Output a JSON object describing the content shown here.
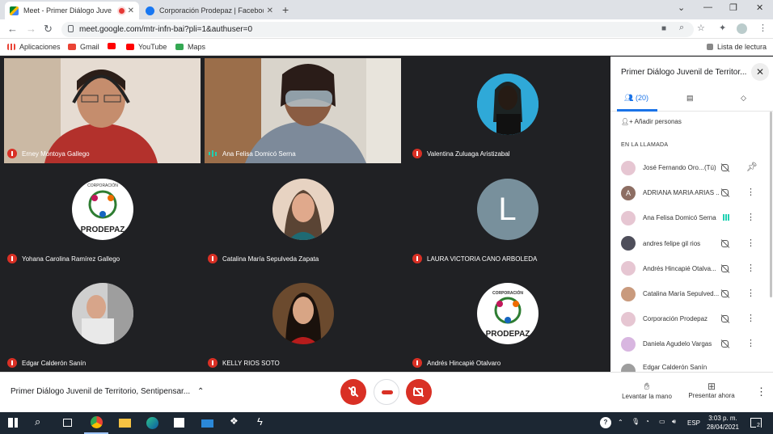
{
  "browser": {
    "tabs": [
      {
        "title": "Meet - Primer Diálogo Juve",
        "recording": true
      },
      {
        "title": "Corporación Prodepaz | Faceboo"
      }
    ],
    "url": "meet.google.com/mtr-infn-bai?pli=1&authuser=0",
    "bookmarks": [
      "Aplicaciones",
      "Gmail",
      "YouTube",
      "Maps"
    ],
    "reading_list": "Lista de lectura"
  },
  "tiles": [
    {
      "name": "Erney Montoya Gallego",
      "muted": true,
      "type": "video"
    },
    {
      "name": "Ana Felisa Domicó Serna",
      "muted": false,
      "type": "video"
    },
    {
      "name": "Valentina Zuluaga Aristizabal",
      "muted": true,
      "type": "photo"
    },
    {
      "name": "Yohana Carolina Ramírez Gallego",
      "muted": true,
      "type": "logo",
      "logo_top": "CORPORACIÓN",
      "logo_bottom": "PRODEPAZ"
    },
    {
      "name": "Catalina María Sepulveda Zapata",
      "muted": true,
      "type": "photo"
    },
    {
      "name": "LAURA VICTORIA CANO ARBOLEDA",
      "muted": true,
      "type": "letter",
      "letter": "L"
    },
    {
      "name": "Edgar Calderón Sanín",
      "muted": true,
      "type": "photo"
    },
    {
      "name": "KELLY RIOS SOTO",
      "muted": true,
      "type": "photo"
    },
    {
      "name": "Andrés Hincapié Otalvaro",
      "muted": true,
      "type": "logo",
      "logo_top": "CORPORACIÓN",
      "logo_bottom": "PRODEPAZ"
    }
  ],
  "bottom": {
    "meeting_title": "Primer Diálogo Juvenil de Territorio, Sentipensar...",
    "raise_hand": "Levantar la mano",
    "present": "Presentar ahora"
  },
  "panel": {
    "title": "Primer Diálogo Juvenil de Territor...",
    "people_count": "(20)",
    "add_people": "Añadir personas",
    "section": "EN LA LLAMADA",
    "participants": [
      {
        "name": "José Fernando Oro...",
        "you": "(Tú)",
        "initial": ""
      },
      {
        "name": "ADRIANA MARIA ARIAS ...",
        "initial": "A"
      },
      {
        "name": "Ana Felisa Domicó Serna",
        "initial": "",
        "speaking": true
      },
      {
        "name": "andres felipe gil rios",
        "initial": ""
      },
      {
        "name": "Andrés Hincapié Otalva...",
        "initial": ""
      },
      {
        "name": "Catalina María Sepulved...",
        "initial": ""
      },
      {
        "name": "Corporación Prodepaz",
        "initial": ""
      },
      {
        "name": "Daniela Agudelo Vargas",
        "initial": ""
      },
      {
        "name": "Edgar Calderón Sanín",
        "initial": ""
      }
    ]
  },
  "taskbar": {
    "lang": "ESP",
    "time": "3:03 p. m.",
    "date": "28/04/2021",
    "notifications": "2"
  },
  "colors": {
    "accent": "#1a73e8",
    "danger": "#d93025",
    "speaking": "#1fd1b2"
  }
}
